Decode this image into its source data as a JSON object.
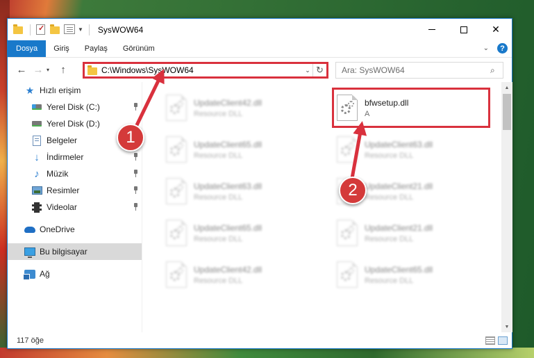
{
  "window": {
    "title": "SysWOW64"
  },
  "ribbon": {
    "tabs": [
      {
        "label": "Dosya",
        "active": true
      },
      {
        "label": "Giriş",
        "active": false
      },
      {
        "label": "Paylaş",
        "active": false
      },
      {
        "label": "Görünüm",
        "active": false
      }
    ],
    "help_label": "?"
  },
  "nav": {
    "back_icon": "back-arrow-icon",
    "forward_icon": "forward-arrow-icon",
    "up_icon": "up-arrow-icon",
    "address_path": "C:\\Windows\\SysWOW64",
    "search_placeholder": "Ara: SysWOW64"
  },
  "sidebar": {
    "items": [
      {
        "label": "Hızlı erişim",
        "icon": "star-icon",
        "pinned": false
      },
      {
        "label": "Yerel Disk (C:)",
        "icon": "drive-c-icon",
        "pinned": true
      },
      {
        "label": "Yerel Disk (D:)",
        "icon": "drive-d-icon",
        "pinned": false
      },
      {
        "label": "Belgeler",
        "icon": "documents-icon",
        "pinned": false
      },
      {
        "label": "İndirmeler",
        "icon": "downloads-icon",
        "pinned": true
      },
      {
        "label": "Müzik",
        "icon": "music-icon",
        "pinned": true
      },
      {
        "label": "Resimler",
        "icon": "pictures-icon",
        "pinned": true
      },
      {
        "label": "Videolar",
        "icon": "videos-icon",
        "pinned": true
      },
      {
        "label": "OneDrive",
        "icon": "onedrive-icon",
        "pinned": false
      },
      {
        "label": "Bu bilgisayar",
        "icon": "this-pc-icon",
        "pinned": false,
        "selected": true
      },
      {
        "label": "Ağ",
        "icon": "network-icon",
        "pinned": false
      }
    ]
  },
  "files": {
    "col1": [
      {
        "name": "UpdateClient42.dll",
        "type": "Resource DLL"
      },
      {
        "name": "UpdateClient65.dll",
        "type": "Resource DLL"
      },
      {
        "name": "UpdateClient63.dll",
        "type": "Resource DLL"
      },
      {
        "name": "UpdateClient65.dll",
        "type": "Resource DLL"
      },
      {
        "name": "UpdateClient42.dll",
        "type": "Resource DLL"
      }
    ],
    "highlighted": {
      "name": "bfwsetup.dll",
      "type": "A"
    },
    "col2": [
      {
        "name": "UpdateClient63.dll",
        "type": "Resource DLL"
      },
      {
        "name": "UpdateClient21.dll",
        "type": "Resource DLL"
      },
      {
        "name": "UpdateClient21.dll",
        "type": "Resource DLL"
      },
      {
        "name": "UpdateClient65.dll",
        "type": "Resource DLL"
      }
    ]
  },
  "status": {
    "item_count": "117 öğe"
  },
  "markers": {
    "one": "1",
    "two": "2"
  },
  "colors": {
    "accent": "#1979ca",
    "annotation_red": "#d9313d"
  }
}
